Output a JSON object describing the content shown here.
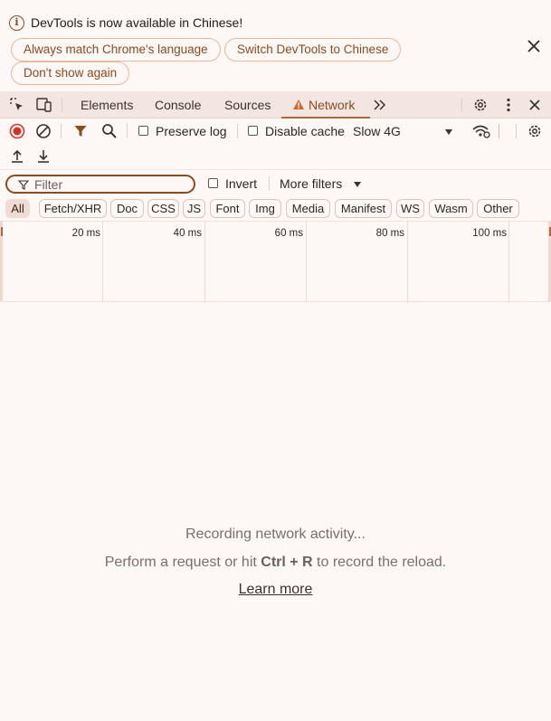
{
  "infobar": {
    "message": "DevTools is now available in Chinese!",
    "buttons": {
      "always_match": "Always match Chrome's language",
      "switch_chinese": "Switch DevTools to Chinese",
      "dont_show": "Don't show again"
    }
  },
  "tabs": {
    "elements": "Elements",
    "console": "Console",
    "sources": "Sources",
    "network": "Network",
    "more": "»"
  },
  "toolbar": {
    "preserve_log": "Preserve log",
    "disable_cache": "Disable cache",
    "throttling": "Slow 4G"
  },
  "filter": {
    "placeholder": "Filter",
    "invert": "Invert",
    "more_filters": "More filters"
  },
  "type_filters": [
    "All",
    "Fetch/XHR",
    "Doc",
    "CSS",
    "JS",
    "Font",
    "Img",
    "Media",
    "Manifest",
    "WS",
    "Wasm",
    "Other"
  ],
  "overview": {
    "ticks": [
      "20 ms",
      "40 ms",
      "60 ms",
      "80 ms",
      "100 ms"
    ]
  },
  "empty_state": {
    "title": "Recording network activity...",
    "hint_before": "Perform a request or hit ",
    "shortcut": "Ctrl + R",
    "hint_after": " to record the reload.",
    "learn_more": "Learn more"
  },
  "colors": {
    "accent": "#8a4b1f",
    "warning": "#d06a2a",
    "record": "#d93025",
    "background": "#fdf7f6",
    "tabbar": "#f3e6e2"
  }
}
